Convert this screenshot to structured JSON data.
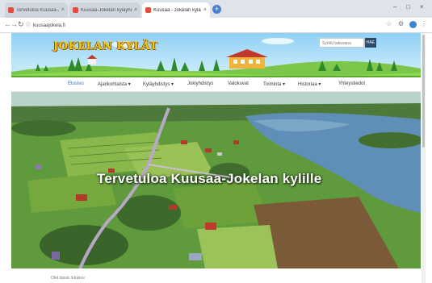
{
  "browser": {
    "tabs": [
      {
        "label": "Tervetuloa Kuusaa-Jokelan",
        "favicon_color": "#e44d3a",
        "active": false
      },
      {
        "label": "Kuusaa-Jokelan kyläyhdistys",
        "favicon_color": "#e44d3a",
        "active": false
      },
      {
        "label": "Kuusaa - Jokelan kylät",
        "favicon_color": "#e44d3a",
        "active": true
      }
    ],
    "new_tab_label": "+",
    "url": "kuusaajokela.fi"
  },
  "site": {
    "logo_text": "JOKELAN KYLÄT",
    "search_placeholder": "Syötä hakusana",
    "search_button": "HAE",
    "nav": [
      "Etusivu",
      "Ajankohtaista ▾",
      "Kyläyhdistys ▾",
      "Jokiyhdistys",
      "Valokuvat",
      "Toiminta ▾",
      "Historiaa ▾",
      "Yhteystiedot"
    ],
    "hero_title": "Tervetuloa Kuusaa-Jokelan kylille",
    "breadcrumb": "Olet tässä: Etusivu"
  },
  "colors": {
    "accent": "#3b73c4",
    "search_button": "#2c4a6b",
    "logo": "#f3c318"
  }
}
